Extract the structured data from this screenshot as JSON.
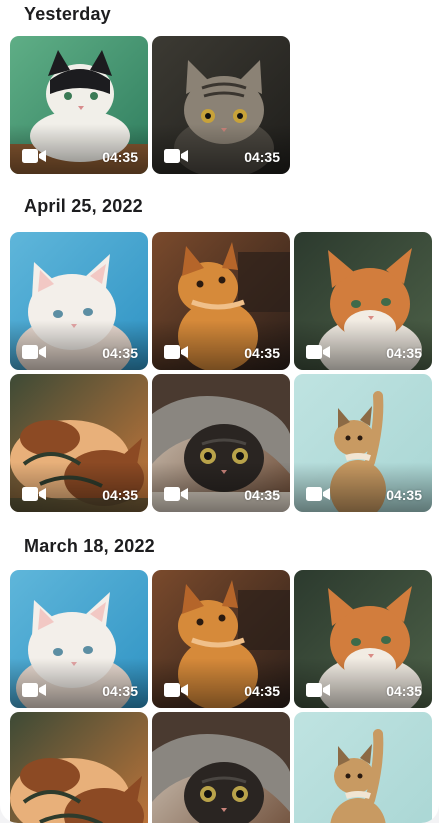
{
  "sections": [
    {
      "title": "Yesterday",
      "items": [
        {
          "duration": "04:35",
          "subject": "black-white-cat",
          "colors": [
            "#5fae86",
            "#2f7d5e",
            "#f1efe9",
            "#1c1c1f",
            "#8a5a32"
          ]
        },
        {
          "duration": "04:35",
          "subject": "tabby-cat",
          "colors": [
            "#3c3a33",
            "#1f1e1b",
            "#8b8275",
            "#4b4740",
            "#c7a23a"
          ]
        }
      ]
    },
    {
      "title": "April 25, 2022",
      "items": [
        {
          "duration": "04:35",
          "subject": "white-cat",
          "colors": [
            "#5fb6da",
            "#2f93c4",
            "#f3efea",
            "#e7d9cf",
            "#a9c8d8"
          ]
        },
        {
          "duration": "04:35",
          "subject": "orange-kitten-looking-up",
          "colors": [
            "#7a4a2c",
            "#2b1f1a",
            "#d68a3a",
            "#b5652a",
            "#f0c08a"
          ]
        },
        {
          "duration": "04:35",
          "subject": "orange-white-cat",
          "colors": [
            "#2c3a2e",
            "#4d6148",
            "#d27d3d",
            "#f2ece3",
            "#b05f2b"
          ]
        },
        {
          "duration": "04:35",
          "subject": "ginger-cat-lying",
          "colors": [
            "#3d4a36",
            "#c9783a",
            "#e8b07a",
            "#8c4a24",
            "#2e3b2c"
          ]
        },
        {
          "duration": "04:35",
          "subject": "grey-cat-under-blanket",
          "colors": [
            "#d8cfc2",
            "#6b4a35",
            "#4a3a30",
            "#8a8680",
            "#2a2522"
          ]
        },
        {
          "duration": "04:35",
          "subject": "kitten-raising-paw",
          "colors": [
            "#bfe3e1",
            "#a9d6d4",
            "#c89a62",
            "#8c6a45",
            "#f1e5d3"
          ]
        }
      ]
    },
    {
      "title": "March 18, 2022",
      "items": [
        {
          "duration": "04:35",
          "subject": "white-cat",
          "colors": [
            "#5fb6da",
            "#2f93c4",
            "#f3efea",
            "#e7d9cf",
            "#a9c8d8"
          ]
        },
        {
          "duration": "04:35",
          "subject": "orange-kitten-looking-up",
          "colors": [
            "#7a4a2c",
            "#2b1f1a",
            "#d68a3a",
            "#b5652a",
            "#f0c08a"
          ]
        },
        {
          "duration": "04:35",
          "subject": "orange-white-cat",
          "colors": [
            "#2c3a2e",
            "#4d6148",
            "#d27d3d",
            "#f2ece3",
            "#b05f2b"
          ]
        },
        {
          "duration": "",
          "subject": "ginger-cat-lying",
          "colors": [
            "#3d4a36",
            "#c9783a",
            "#e8b07a",
            "#8c4a24",
            "#2e3b2c"
          ]
        },
        {
          "duration": "",
          "subject": "grey-cat-under-blanket",
          "colors": [
            "#d8cfc2",
            "#6b4a35",
            "#4a3a30",
            "#8a8680",
            "#2a2522"
          ]
        },
        {
          "duration": "",
          "subject": "kitten-raising-paw",
          "colors": [
            "#bfe3e1",
            "#a9d6d4",
            "#c89a62",
            "#8c6a45",
            "#f1e5d3"
          ]
        }
      ]
    }
  ],
  "icons": {
    "video": "video-camera-icon"
  }
}
